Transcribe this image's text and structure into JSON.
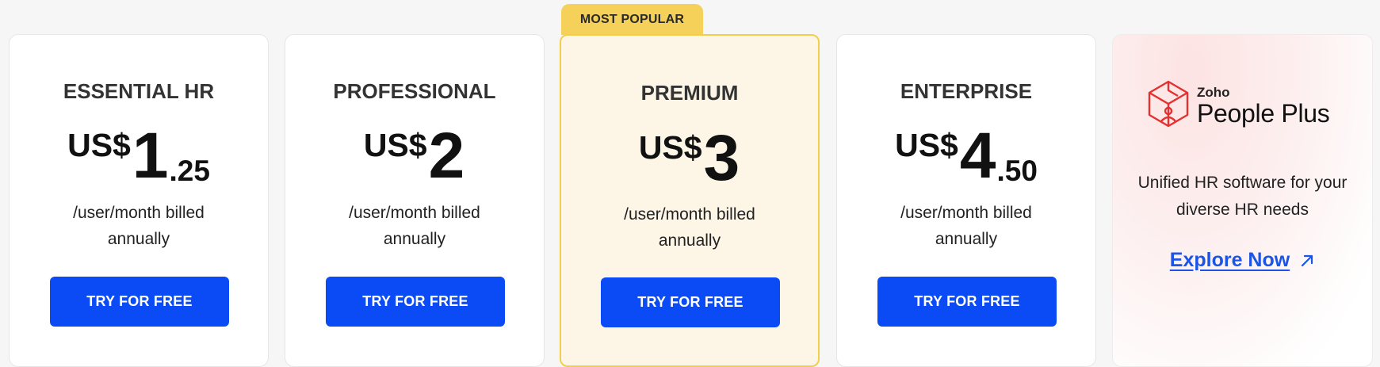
{
  "badge": {
    "label": "MOST POPULAR"
  },
  "plans": [
    {
      "name": "ESSENTIAL HR",
      "currency": "US$",
      "price_int": "1",
      "price_dec": ".25",
      "period": "/user/month billed annually",
      "cta": "TRY FOR FREE"
    },
    {
      "name": "PROFESSIONAL",
      "currency": "US$",
      "price_int": "2",
      "price_dec": "",
      "period": "/user/month billed annually",
      "cta": "TRY FOR FREE"
    },
    {
      "name": "PREMIUM",
      "currency": "US$",
      "price_int": "3",
      "price_dec": "",
      "period": "/user/month billed annually",
      "cta": "TRY FOR FREE"
    },
    {
      "name": "ENTERPRISE",
      "currency": "US$",
      "price_int": "4",
      "price_dec": ".50",
      "period": "/user/month billed annually",
      "cta": "TRY FOR FREE"
    }
  ],
  "promo": {
    "brand": "Zoho",
    "product": "People Plus",
    "logo_icon": "people-plus-logo-icon",
    "description": "Unified HR software for your diverse HR needs",
    "link_label": "Explore Now",
    "link_icon": "arrow-up-right-icon"
  },
  "colors": {
    "accent": "#0a4bf5",
    "popular_bg": "#fdf6e7",
    "popular_border": "#f2cf4a",
    "badge_bg": "#f6d15a",
    "logo_red": "#e4312f",
    "link": "#1a55e8"
  }
}
